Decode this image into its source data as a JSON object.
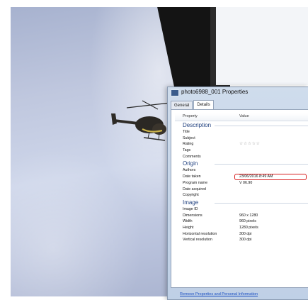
{
  "dialog": {
    "title": "photo6988_001 Properties",
    "tabs": [
      {
        "label": "General",
        "active": false
      },
      {
        "label": "Details",
        "active": true
      }
    ],
    "columns": {
      "property": "Property",
      "value": "Value"
    },
    "groups": [
      {
        "name": "Description",
        "rows": [
          {
            "property": "Title",
            "value": ""
          },
          {
            "property": "Subject",
            "value": ""
          },
          {
            "property": "Rating",
            "value": "☆☆☆☆☆"
          },
          {
            "property": "Tags",
            "value": ""
          },
          {
            "property": "Comments",
            "value": ""
          }
        ]
      },
      {
        "name": "Origin",
        "rows": [
          {
            "property": "Authors",
            "value": ""
          },
          {
            "property": "Date taken",
            "value": "23/06/2016 8:49 AM",
            "highlighted": true
          },
          {
            "property": "Program name",
            "value": "V 06.90"
          },
          {
            "property": "Date acquired",
            "value": ""
          },
          {
            "property": "Copyright",
            "value": ""
          }
        ]
      },
      {
        "name": "Image",
        "rows": [
          {
            "property": "Image ID",
            "value": ""
          },
          {
            "property": "Dimensions",
            "value": "960 x 1280"
          },
          {
            "property": "Width",
            "value": "960 pixels"
          },
          {
            "property": "Height",
            "value": "1280 pixels"
          },
          {
            "property": "Horizontal resolution",
            "value": "300 dpi"
          },
          {
            "property": "Vertical resolution",
            "value": "300 dpi"
          }
        ]
      }
    ],
    "footer_link": "Remove Properties and Personal Information",
    "highlight_color": "#d81e1e"
  }
}
